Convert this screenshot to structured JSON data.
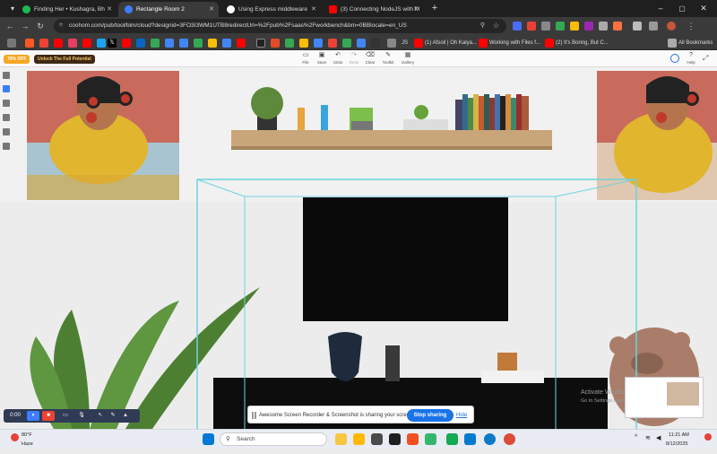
{
  "browser": {
    "tabs": [
      {
        "title": "Finding Her • Kushagra, Bh",
        "color": "#1db954",
        "active": false
      },
      {
        "title": "Rectangle Room 2",
        "color": "#3d7eff",
        "active": true
      },
      {
        "title": "Using Express middleware",
        "color": "#ffffff",
        "active": false
      },
      {
        "title": "(3) Connecting NodeJS with M",
        "color": "#ff0000",
        "active": false
      }
    ],
    "new_tab": "+",
    "url": "coohom.com/pub/tool/bim/cloud?designid=3FO3I3WM1UTB8redirectUrl=%2Fpub%2Fsaas%2Fworkbench&bm=0BBlocale=en_US",
    "bookmarks_right": "All Bookmarks",
    "bookmarks": [
      {
        "label": "(1) Afsoil | Oh Kalya...",
        "color": "#ff0000"
      },
      {
        "label": "Working with Files f...",
        "color": "#ff0000"
      },
      {
        "label": "(2) It's Boring, But C...",
        "color": "#ff0000"
      }
    ],
    "bookmark_prefix": "JS"
  },
  "app": {
    "promo_left": "70% OFF",
    "promo_right": "Unlock The Full Potential",
    "tools": [
      {
        "icon": "▭",
        "label": "File"
      },
      {
        "icon": "▣",
        "label": "Save"
      },
      {
        "icon": "↶",
        "label": "Undo"
      },
      {
        "icon": "↷",
        "label": "Redo"
      },
      {
        "icon": "⌫",
        "label": "Clear"
      },
      {
        "icon": "✎",
        "label": "Toolkit"
      },
      {
        "icon": "▦",
        "label": "Gallery"
      }
    ],
    "right_help": "Help",
    "statusbar": {
      "time": "0:00"
    },
    "share_notice": "Awesome Screen Recorder & Screenshot is sharing your screen.",
    "stop_button": "Stop sharing",
    "hide_button": "Hide",
    "watermark_1": "Activate Windows",
    "watermark_2": "Go to Settings to activate W"
  },
  "taskbar": {
    "weather_temp": "80°F",
    "weather_desc": "Haze",
    "search_placeholder": "Search",
    "time": "11:21 AM",
    "date": "8/12/2025"
  },
  "colors": {
    "accent": "#1a73e8",
    "selection": "#6ed3de",
    "shelf": "#c9a57a",
    "tv": "#0a0a0a"
  }
}
